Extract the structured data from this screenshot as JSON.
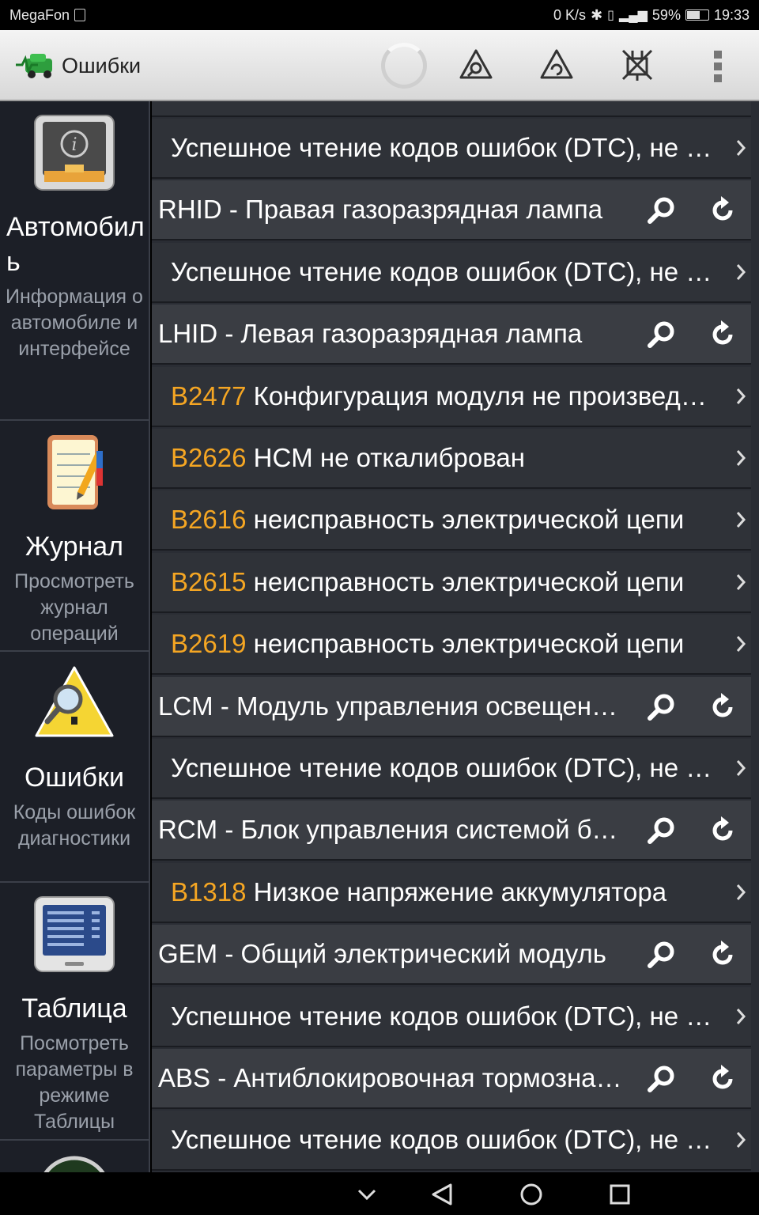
{
  "status_bar": {
    "carrier": "MegaFon",
    "speed": "0 K/s",
    "battery": "59%",
    "time": "19:33"
  },
  "action_bar": {
    "title": "Ошибки",
    "buttons": [
      "dtc-scan-icon",
      "dtc-scan-alt-icon",
      "no-connection-icon",
      "overflow-menu-icon"
    ]
  },
  "sidebar": {
    "items": [
      {
        "title": "Автомобиль",
        "desc": "Информация о автомобиле и интерфейсе",
        "icon": "car-info-icon"
      },
      {
        "title": "Журнал",
        "desc": "Просмотреть журнал операций",
        "icon": "notebook-icon"
      },
      {
        "title": "Ошибки",
        "desc": "Коды ошибок диагностики",
        "icon": "warning-magnifier-icon"
      },
      {
        "title": "Таблица",
        "desc": "Посмотреть параметры в режиме Таблицы",
        "icon": "monitor-table-icon"
      }
    ]
  },
  "list": {
    "rows": [
      {
        "type": "sub",
        "code": "",
        "text": "Успешное чтение кодов ошибок (DTC), не обнаружено"
      },
      {
        "type": "module",
        "text": "RHID - Правая газоразрядная лампа"
      },
      {
        "type": "sub",
        "code": "",
        "text": "Успешное чтение кодов ошибок (DTC), не обнаружено"
      },
      {
        "type": "module",
        "text": "LHID - Левая газоразрядная лампа"
      },
      {
        "type": "sub",
        "code": "B2477",
        "text": " Конфигурация модуля не произведена"
      },
      {
        "type": "sub",
        "code": "B2626",
        "text": " HCM не откалиброван"
      },
      {
        "type": "sub",
        "code": "B2616",
        "text": " неисправность электрической цепи"
      },
      {
        "type": "sub",
        "code": "B2615",
        "text": " неисправность электрической цепи"
      },
      {
        "type": "sub",
        "code": "B2619",
        "text": " неисправность электрической цепи"
      },
      {
        "type": "module",
        "text": "LCM - Модуль управления освещением"
      },
      {
        "type": "sub",
        "code": "",
        "text": "Успешное чтение кодов ошибок (DTC), не обнаружено"
      },
      {
        "type": "module",
        "text": "RCM - Блок управления системой безопасности"
      },
      {
        "type": "sub",
        "code": "B1318",
        "text": " Низкое напряжение аккумулятора"
      },
      {
        "type": "module",
        "text": "GEM - Общий электрический модуль"
      },
      {
        "type": "sub",
        "code": "",
        "text": "Успешное чтение кодов ошибок (DTC), не обнаружено"
      },
      {
        "type": "module",
        "text": "ABS - Антиблокировочная тормозная система"
      },
      {
        "type": "sub",
        "code": "",
        "text": "Успешное чтение кодов ошибок (DTC), не обнаружено"
      }
    ]
  },
  "colors": {
    "code": "#f5a623",
    "list_bg": "#2f3238",
    "module_bg": "#3a3d43",
    "sidebar_bg": "#1c1f27"
  }
}
